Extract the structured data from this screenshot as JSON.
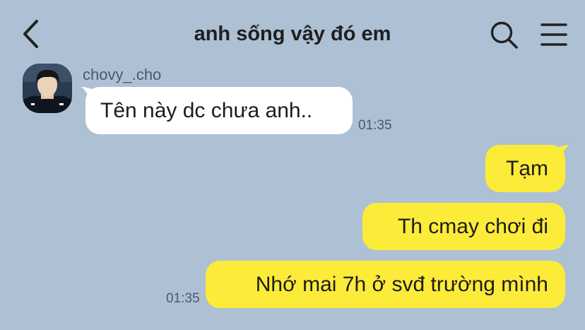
{
  "theme": {
    "background": "#adc0d4",
    "incoming_bubble": "#ffffff",
    "outgoing_bubble": "#fdeb3a"
  },
  "header": {
    "title": "anh sống vậy đó em",
    "back_icon": "chevron-left-icon",
    "search_icon": "search-icon",
    "menu_icon": "hamburger-menu-icon"
  },
  "messages": [
    {
      "direction": "incoming",
      "sender": "chovy_.cho",
      "text": "Tên này dc chưa anh..",
      "time": "01:35",
      "avatar": "profile-photo"
    },
    {
      "direction": "outgoing",
      "text": "Tạm"
    },
    {
      "direction": "outgoing",
      "text": "Th cmay chơi đi"
    },
    {
      "direction": "outgoing",
      "text": "Nhớ mai 7h ở svđ trường mình",
      "time": "01:35"
    }
  ]
}
